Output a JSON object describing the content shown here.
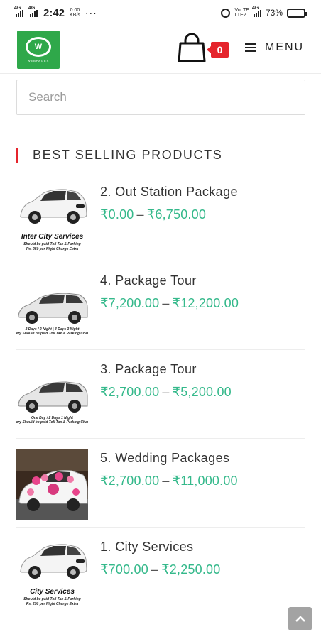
{
  "status_bar": {
    "net1": "4G",
    "net2": "4G",
    "time": "2:42",
    "speed_value": "0.00",
    "speed_unit": "KB/s",
    "dots": "···",
    "volte": "VoLTE",
    "lte": "LTE2",
    "net3": "4G",
    "battery_pct": "73%",
    "battery_level": 0.73
  },
  "header": {
    "logo_mark": "W",
    "logo_tagline": "WEBPAGES",
    "cart_count": "0",
    "menu_label": "MENU"
  },
  "search": {
    "placeholder": "Search",
    "value": ""
  },
  "section": {
    "title": "BEST SELLING PRODUCTS"
  },
  "products": [
    {
      "title": "2. Out Station Package",
      "price_min": "₹0.00",
      "price_max": "₹6,750.00",
      "caption_main": "Inter City Services",
      "caption_sub": "Should be paid Toll Tax & Parking",
      "caption_sub2": "Rs. 250 per Night Charge Extra",
      "image": "white-car"
    },
    {
      "title": "4. Package Tour",
      "price_min": "₹7,200.00",
      "price_max": "₹12,200.00",
      "caption_main": "",
      "caption_sub": "3 Days / 2 Night | 4 Days 3 Night",
      "caption_sub2": "Every Should be paid Toll Tax & Parking Charge",
      "image": "silver-car"
    },
    {
      "title": "3. Package Tour",
      "price_min": "₹2,700.00",
      "price_max": "₹5,200.00",
      "caption_main": "",
      "caption_sub": "One Day / 2 Days 1 Night",
      "caption_sub2": "Every Should be paid Toll Tax & Parking Charge",
      "image": "silver-car"
    },
    {
      "title": "5. Wedding Packages",
      "price_min": "₹2,700.00",
      "price_max": "₹11,000.00",
      "caption_main": "",
      "caption_sub": "",
      "caption_sub2": "",
      "image": "wedding-car"
    },
    {
      "title": "1. City Services",
      "price_min": "₹700.00",
      "price_max": "₹2,250.00",
      "caption_main": "City Services",
      "caption_sub": "Should be paid Toll Tax & Parking",
      "caption_sub2": "Rs. 250 per Night Charge Extra",
      "image": "white-car"
    }
  ],
  "price_separator": "–",
  "colors": {
    "accent": "#e5242c",
    "price": "#35b98b",
    "logo": "#2fa84a",
    "to_top": "#a3a3a3"
  }
}
